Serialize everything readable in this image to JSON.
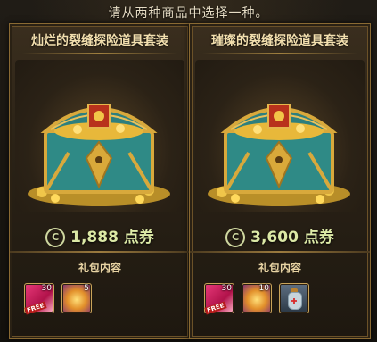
{
  "prompt": "请从两种商品中选择一种。",
  "contents_label": "礼包内容",
  "currency_icon": "coupon-icon",
  "packages": [
    {
      "title": "灿烂的裂缝探险道具套装",
      "price": "1,888 点券",
      "items": [
        {
          "icon": "red-ticket-free",
          "qty": "30",
          "tag": "FREE"
        },
        {
          "icon": "gold-burst",
          "qty": "5"
        }
      ]
    },
    {
      "title": "璀璨的裂缝探险道具套装",
      "price": "3,600 点券",
      "items": [
        {
          "icon": "red-ticket-free",
          "qty": "30",
          "tag": "FREE"
        },
        {
          "icon": "gold-burst",
          "qty": "10"
        },
        {
          "icon": "potion-bottle",
          "qty": ""
        }
      ]
    }
  ],
  "colors": {
    "frame": "#8a6a33",
    "price": "#dce9a6",
    "title": "#f3dfae"
  }
}
